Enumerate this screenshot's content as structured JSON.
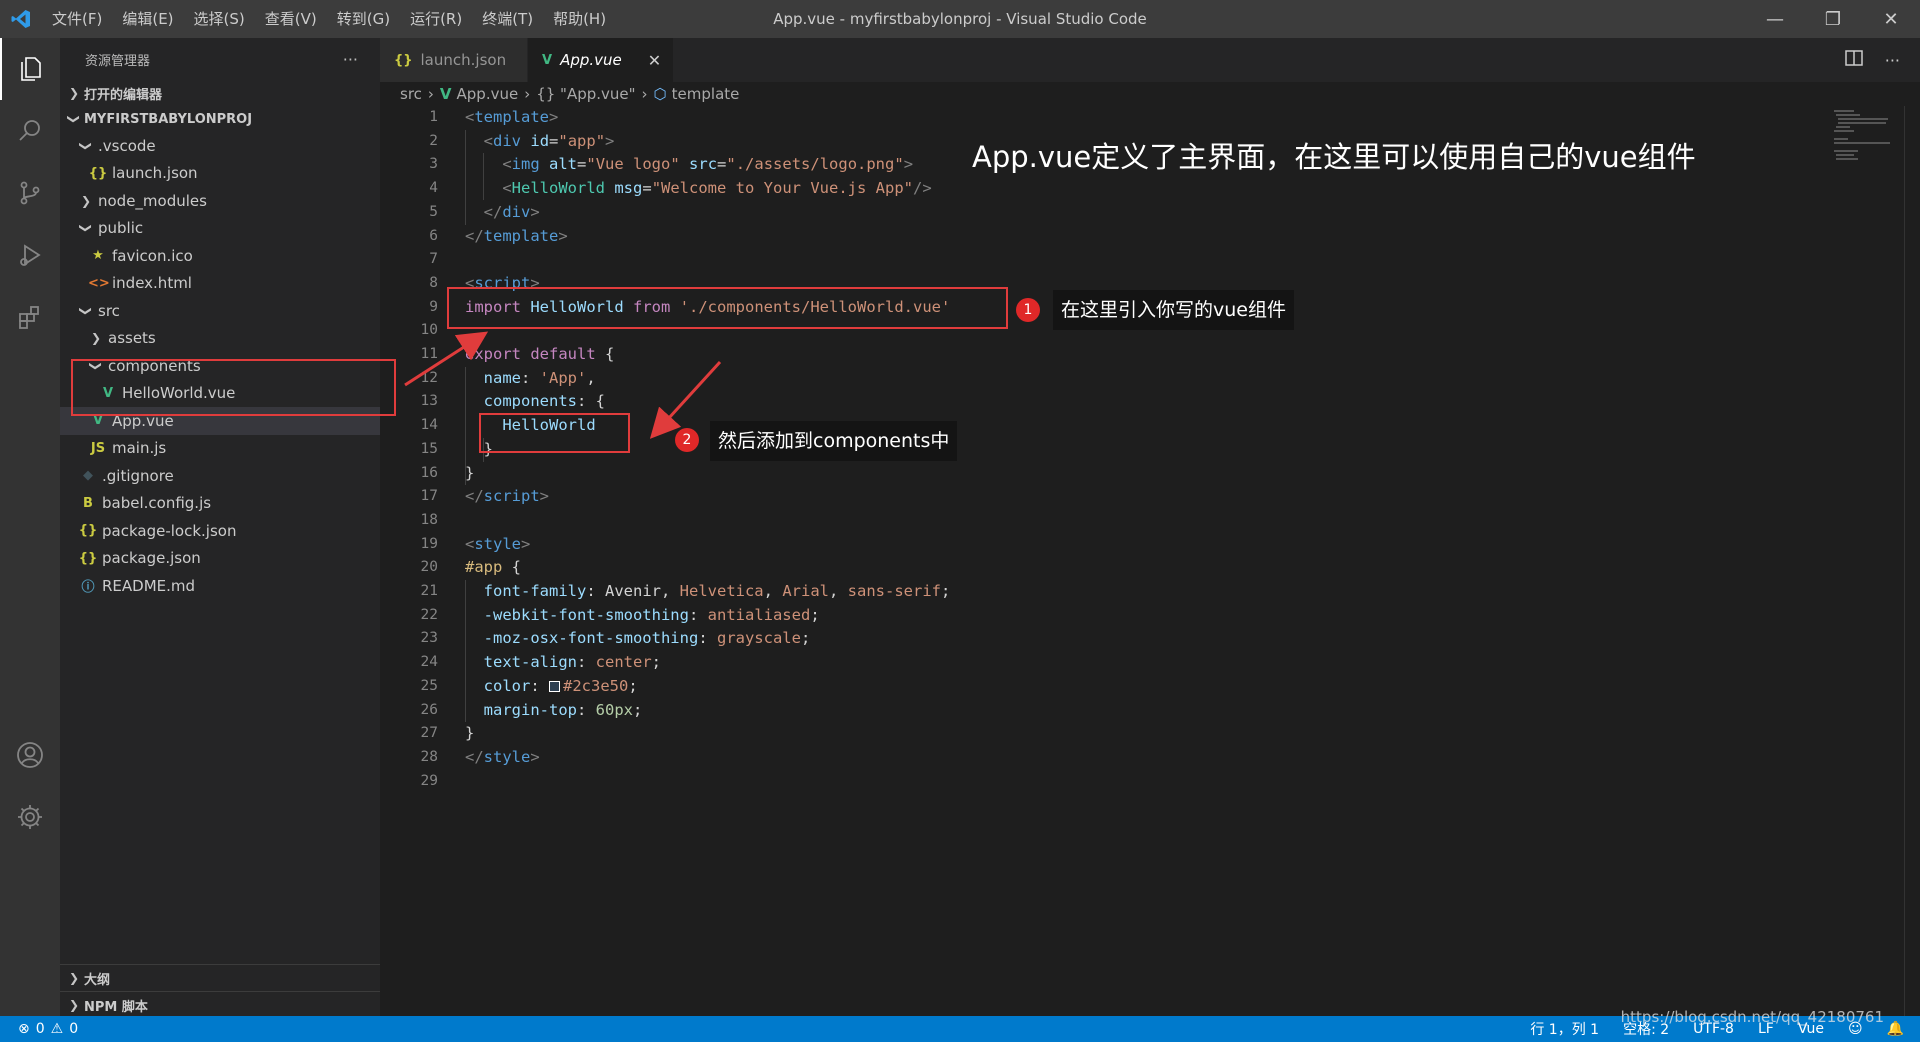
{
  "titlebar": {
    "menu": [
      "文件(F)",
      "编辑(E)",
      "选择(S)",
      "查看(V)",
      "转到(G)",
      "运行(R)",
      "终端(T)",
      "帮助(H)"
    ],
    "window_title": "App.vue - myfirstbabylonproj - Visual Studio Code",
    "controls": {
      "minimize": "—",
      "restore": "❐",
      "close": "✕"
    }
  },
  "sidebar": {
    "title": "资源管理器",
    "more": "···",
    "open_editors": "打开的编辑器",
    "project": "MYFIRSTBABYLONPROJ",
    "tree": [
      {
        "label": ".vscode",
        "icon": "chevron-down",
        "icon_glyph": "",
        "indent": 1,
        "kind": "folder-open"
      },
      {
        "label": "launch.json",
        "icon": "json-icon",
        "icon_glyph": "{}",
        "indent": 2,
        "kind": "file"
      },
      {
        "label": "node_modules",
        "icon": "chevron-right",
        "icon_glyph": "",
        "indent": 1,
        "kind": "folder"
      },
      {
        "label": "public",
        "icon": "chevron-down",
        "icon_glyph": "",
        "indent": 1,
        "kind": "folder-open"
      },
      {
        "label": "favicon.ico",
        "icon": "star-icon",
        "icon_glyph": "★",
        "indent": 2,
        "kind": "file"
      },
      {
        "label": "index.html",
        "icon": "html-icon",
        "icon_glyph": "<>",
        "indent": 2,
        "kind": "file"
      },
      {
        "label": "src",
        "icon": "chevron-down",
        "icon_glyph": "",
        "indent": 1,
        "kind": "folder-open"
      },
      {
        "label": "assets",
        "icon": "chevron-right",
        "icon_glyph": "",
        "indent": 2,
        "kind": "folder"
      },
      {
        "label": "components",
        "icon": "chevron-down",
        "icon_glyph": "",
        "indent": 2,
        "kind": "folder-open"
      },
      {
        "label": "HelloWorld.vue",
        "icon": "vue-icon",
        "icon_glyph": "V",
        "indent": 3,
        "kind": "file"
      },
      {
        "label": "App.vue",
        "icon": "vue-icon",
        "icon_glyph": "V",
        "indent": 2,
        "kind": "file",
        "selected": true
      },
      {
        "label": "main.js",
        "icon": "js-icon",
        "icon_glyph": "JS",
        "indent": 2,
        "kind": "file"
      },
      {
        "label": ".gitignore",
        "icon": "git-icon",
        "icon_glyph": "◆",
        "indent": 1,
        "kind": "file"
      },
      {
        "label": "babel.config.js",
        "icon": "babel-icon",
        "icon_glyph": "B",
        "indent": 1,
        "kind": "file"
      },
      {
        "label": "package-lock.json",
        "icon": "json-icon",
        "icon_glyph": "{}",
        "indent": 1,
        "kind": "file"
      },
      {
        "label": "package.json",
        "icon": "json-icon",
        "icon_glyph": "{}",
        "indent": 1,
        "kind": "file"
      },
      {
        "label": "README.md",
        "icon": "info-icon",
        "icon_glyph": "ⓘ",
        "indent": 1,
        "kind": "file"
      }
    ],
    "outline": "大纲",
    "npm_scripts": "NPM 脚本"
  },
  "tabs": [
    {
      "label": "launch.json",
      "icon_glyph": "{}",
      "active": false
    },
    {
      "label": "App.vue",
      "icon_glyph": "V",
      "active": true,
      "close": "✕"
    }
  ],
  "breadcrumb": [
    "src",
    "App.vue",
    "{} \"App.vue\"",
    "template"
  ],
  "code_lines": [
    [
      [
        "t-br",
        "<"
      ],
      [
        "t-tag",
        "template"
      ],
      [
        "t-br",
        ">"
      ]
    ],
    [
      [
        "t-plain",
        "  "
      ],
      [
        "t-br",
        "<"
      ],
      [
        "t-tag",
        "div"
      ],
      [
        "t-plain",
        " "
      ],
      [
        "t-attr",
        "id"
      ],
      [
        "t-plain",
        "="
      ],
      [
        "t-str",
        "\"app\""
      ],
      [
        "t-br",
        ">"
      ]
    ],
    [
      [
        "t-plain",
        "    "
      ],
      [
        "t-br",
        "<"
      ],
      [
        "t-tag",
        "img"
      ],
      [
        "t-plain",
        " "
      ],
      [
        "t-attr",
        "alt"
      ],
      [
        "t-plain",
        "="
      ],
      [
        "t-str",
        "\"Vue logo\""
      ],
      [
        "t-plain",
        " "
      ],
      [
        "t-attr",
        "src"
      ],
      [
        "t-plain",
        "="
      ],
      [
        "t-str",
        "\"./assets/logo.png\""
      ],
      [
        "t-br",
        ">"
      ]
    ],
    [
      [
        "t-plain",
        "    "
      ],
      [
        "t-br",
        "<"
      ],
      [
        "t-comp",
        "HelloWorld"
      ],
      [
        "t-plain",
        " "
      ],
      [
        "t-attr",
        "msg"
      ],
      [
        "t-plain",
        "="
      ],
      [
        "t-str",
        "\"Welcome to Your Vue.js App\""
      ],
      [
        "t-br",
        "/>"
      ]
    ],
    [
      [
        "t-plain",
        "  "
      ],
      [
        "t-br",
        "</"
      ],
      [
        "t-tag",
        "div"
      ],
      [
        "t-br",
        ">"
      ]
    ],
    [
      [
        "t-br",
        "</"
      ],
      [
        "t-tag",
        "template"
      ],
      [
        "t-br",
        ">"
      ]
    ],
    [],
    [
      [
        "t-br",
        "<"
      ],
      [
        "t-tag",
        "script"
      ],
      [
        "t-br",
        ">"
      ]
    ],
    [
      [
        "t-kw",
        "import"
      ],
      [
        "t-plain",
        " "
      ],
      [
        "t-id",
        "HelloWorld"
      ],
      [
        "t-plain",
        " "
      ],
      [
        "t-kw",
        "from"
      ],
      [
        "t-plain",
        " "
      ],
      [
        "t-str",
        "'./components/HelloWorld.vue'"
      ]
    ],
    [],
    [
      [
        "t-kw",
        "export"
      ],
      [
        "t-plain",
        " "
      ],
      [
        "t-kw",
        "default"
      ],
      [
        "t-plain",
        " {"
      ]
    ],
    [
      [
        "t-plain",
        "  "
      ],
      [
        "t-prop",
        "name"
      ],
      [
        "t-plain",
        ": "
      ],
      [
        "t-str",
        "'App'"
      ],
      [
        "t-plain",
        ","
      ]
    ],
    [
      [
        "t-plain",
        "  "
      ],
      [
        "t-prop",
        "components"
      ],
      [
        "t-plain",
        ": {"
      ]
    ],
    [
      [
        "t-plain",
        "    "
      ],
      [
        "t-id",
        "HelloWorld"
      ]
    ],
    [
      [
        "t-plain",
        "  }"
      ]
    ],
    [
      [
        "t-plain",
        "}"
      ]
    ],
    [
      [
        "t-br",
        "</"
      ],
      [
        "t-tag",
        "script"
      ],
      [
        "t-br",
        ">"
      ]
    ],
    [],
    [
      [
        "t-br",
        "<"
      ],
      [
        "t-tag",
        "style"
      ],
      [
        "t-br",
        ">"
      ]
    ],
    [
      [
        "t-sel",
        "#app"
      ],
      [
        "t-plain",
        " {"
      ]
    ],
    [
      [
        "t-plain",
        "  "
      ],
      [
        "t-prop",
        "font-family"
      ],
      [
        "t-plain",
        ": Avenir, "
      ],
      [
        "t-val",
        "Helvetica"
      ],
      [
        "t-plain",
        ", "
      ],
      [
        "t-val",
        "Arial"
      ],
      [
        "t-plain",
        ", "
      ],
      [
        "t-val",
        "sans-serif"
      ],
      [
        "t-plain",
        ";"
      ]
    ],
    [
      [
        "t-plain",
        "  "
      ],
      [
        "t-prop",
        "-webkit-font-smoothing"
      ],
      [
        "t-plain",
        ": "
      ],
      [
        "t-val",
        "antialiased"
      ],
      [
        "t-plain",
        ";"
      ]
    ],
    [
      [
        "t-plain",
        "  "
      ],
      [
        "t-prop",
        "-moz-osx-font-smoothing"
      ],
      [
        "t-plain",
        ": "
      ],
      [
        "t-val",
        "grayscale"
      ],
      [
        "t-plain",
        ";"
      ]
    ],
    [
      [
        "t-plain",
        "  "
      ],
      [
        "t-prop",
        "text-align"
      ],
      [
        "t-plain",
        ": "
      ],
      [
        "t-val",
        "center"
      ],
      [
        "t-plain",
        ";"
      ]
    ],
    [
      [
        "t-plain",
        "  "
      ],
      [
        "t-prop",
        "color"
      ],
      [
        "t-plain",
        ": "
      ],
      [
        "swatch",
        ""
      ],
      [
        "t-val",
        "#2c3e50"
      ],
      [
        "t-plain",
        ";"
      ]
    ],
    [
      [
        "t-plain",
        "  "
      ],
      [
        "t-prop",
        "margin-top"
      ],
      [
        "t-plain",
        ": "
      ],
      [
        "t-num",
        "60px"
      ],
      [
        "t-plain",
        ";"
      ]
    ],
    [
      [
        "t-plain",
        "}"
      ]
    ],
    [
      [
        "t-br",
        "</"
      ],
      [
        "t-tag",
        "style"
      ],
      [
        "t-br",
        ">"
      ]
    ],
    []
  ],
  "annotations": {
    "heading": "App.vue定义了主界面，在这里可以使用自己的vue组件",
    "badge1": "1",
    "label1": "在这里引入你写的vue组件",
    "badge2": "2",
    "label2": "然后添加到components中"
  },
  "statusbar": {
    "errors": "0",
    "warnings": "0",
    "position": "行 1，列 1",
    "spaces": "空格: 2",
    "encoding": "UTF-8",
    "eol": "LF",
    "language": "Vue"
  },
  "watermark": "https://blog.csdn.net/qq_42180761",
  "colors": {
    "accent": "#007acc",
    "annotation_red": "#e03c3c",
    "vue_green": "#41b883"
  }
}
